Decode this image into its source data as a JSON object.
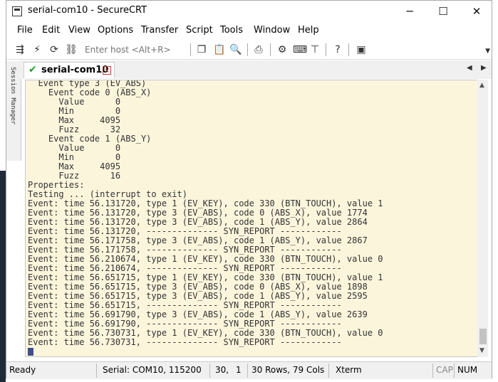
{
  "window": {
    "title": "serial-com10 - SecureCRT",
    "controls": {
      "minimize": "─",
      "maximize": "☐",
      "close": "✕"
    }
  },
  "menu": [
    "File",
    "Edit",
    "View",
    "Options",
    "Transfer",
    "Script",
    "Tools",
    "Window",
    "Help"
  ],
  "toolbar": {
    "host_placeholder": "Enter host <Alt+R>",
    "icons": [
      "connect-icon",
      "lightning-icon",
      "reconnect-icon",
      "disconnect-icon",
      "copy-icon",
      "paste-icon",
      "find-icon",
      "print-icon",
      "settings-icon",
      "keymap-icon",
      "sftp-icon",
      "help-icon",
      "sessions-icon"
    ]
  },
  "session_manager": {
    "label": "Session Manager"
  },
  "tabs": [
    {
      "label": "serial-com10",
      "active": true
    }
  ],
  "terminal": {
    "lines": [
      "  Event type 3 (EV_ABS)",
      "    Event code 0 (ABS_X)",
      "      Value      0",
      "      Min        0",
      "      Max     4095",
      "      Fuzz      32",
      "    Event code 1 (ABS_Y)",
      "      Value      0",
      "      Min        0",
      "      Max     4095",
      "      Fuzz      16",
      "Properties:",
      "Testing ... (interrupt to exit)",
      "Event: time 56.131720, type 1 (EV_KEY), code 330 (BTN_TOUCH), value 1",
      "Event: time 56.131720, type 3 (EV_ABS), code 0 (ABS_X), value 1774",
      "Event: time 56.131720, type 3 (EV_ABS), code 1 (ABS_Y), value 2864",
      "Event: time 56.131720, -------------- SYN_REPORT ------------",
      "Event: time 56.171758, type 3 (EV_ABS), code 1 (ABS_Y), value 2867",
      "Event: time 56.171758, -------------- SYN_REPORT ------------",
      "Event: time 56.210674, type 1 (EV_KEY), code 330 (BTN_TOUCH), value 0",
      "Event: time 56.210674, -------------- SYN_REPORT ------------",
      "Event: time 56.651715, type 1 (EV_KEY), code 330 (BTN_TOUCH), value 1",
      "Event: time 56.651715, type 3 (EV_ABS), code 0 (ABS_X), value 1898",
      "Event: time 56.651715, type 3 (EV_ABS), code 1 (ABS_Y), value 2595",
      "Event: time 56.651715, -------------- SYN_REPORT ------------",
      "Event: time 56.691790, type 3 (EV_ABS), code 1 (ABS_Y), value 2639",
      "Event: time 56.691790, -------------- SYN_REPORT ------------",
      "Event: time 56.730731, type 1 (EV_KEY), code 330 (BTN_TOUCH), value 0",
      "Event: time 56.730731, -------------- SYN_REPORT ------------"
    ],
    "background": "#fbf5dc",
    "foreground": "#333333"
  },
  "status": {
    "ready": "Ready",
    "connection": "Serial: COM10, 115200",
    "row": "30,",
    "col": "1",
    "size": "30 Rows, 79 Cols",
    "emulation": "Xterm",
    "caps": "CAP",
    "num": "NUM"
  },
  "colors": {
    "accent_check": "#2a9d2a",
    "tab_close": "#cc3333",
    "cursor": "#3e4f8c"
  }
}
